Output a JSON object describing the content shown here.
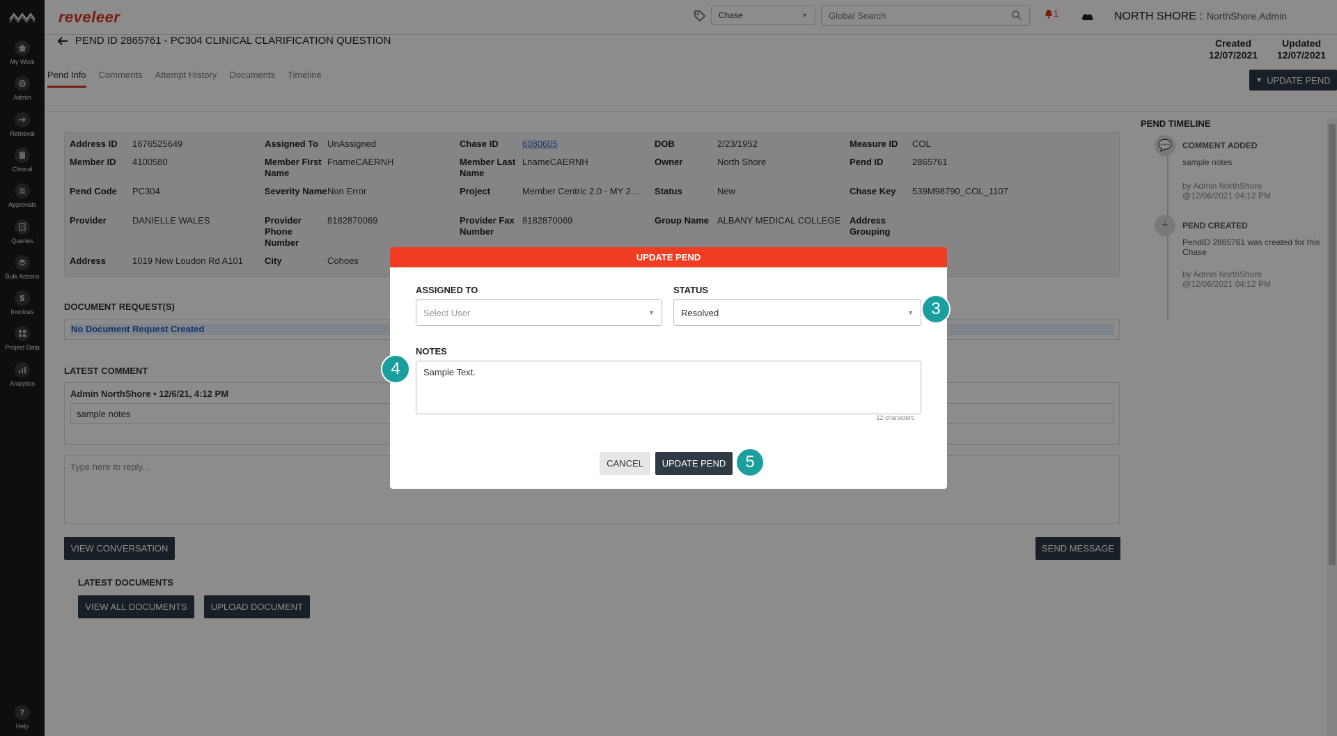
{
  "brand": "reveleer",
  "topbar": {
    "chase_select": "Chase",
    "search_placeholder": "Global Search",
    "notification_count": "1",
    "org": "NORTH SHORE :",
    "user": "NorthShore.Admin"
  },
  "nav": [
    {
      "label": "My Work",
      "icon": "home-icon"
    },
    {
      "label": "Admin",
      "icon": "gear-icon"
    },
    {
      "label": "Retrieval",
      "icon": "arrow-right-icon"
    },
    {
      "label": "Clinical",
      "icon": "clipboard-icon"
    },
    {
      "label": "Approvals",
      "icon": "list-icon"
    },
    {
      "label": "Queries",
      "icon": "document-icon"
    },
    {
      "label": "Bulk Actions",
      "icon": "layers-icon"
    },
    {
      "label": "Invoices",
      "icon": "dollar-icon"
    },
    {
      "label": "Project Data",
      "icon": "grid-icon"
    },
    {
      "label": "Analytics",
      "icon": "chart-icon"
    },
    {
      "label": "Help",
      "icon": "help-icon"
    }
  ],
  "page": {
    "title": "PEND ID 2865761 - PC304 CLINICAL CLARIFICATION QUESTION",
    "created_label": "Created",
    "created_date": "12/07/2021",
    "updated_label": "Updated",
    "updated_date": "12/07/2021",
    "update_button": "UPDATE PEND"
  },
  "tabs": [
    "Pend Info",
    "Comments",
    "Attempt History",
    "Documents",
    "Timeline"
  ],
  "info": {
    "address_id": {
      "label": "Address ID",
      "value": "1676525649"
    },
    "assigned_to": {
      "label": "Assigned To",
      "value": "UnAssigned"
    },
    "chase_id": {
      "label": "Chase ID",
      "value": "6080605"
    },
    "dob": {
      "label": "DOB",
      "value": "2/23/1952"
    },
    "measure_id": {
      "label": "Measure ID",
      "value": "COL"
    },
    "member_id": {
      "label": "Member ID",
      "value": "4100580"
    },
    "member_first": {
      "label": "Member First Name",
      "value": "FnameCAERNH"
    },
    "member_last": {
      "label": "Member Last Name",
      "value": "LnameCAERNH"
    },
    "owner": {
      "label": "Owner",
      "value": "North Shore"
    },
    "pend_id": {
      "label": "Pend ID",
      "value": "2865761"
    },
    "pend_code": {
      "label": "Pend Code",
      "value": "PC304"
    },
    "severity": {
      "label": "Severity Name",
      "value": "Non Error"
    },
    "project": {
      "label": "Project",
      "value": "Member Centric 2.0 - MY 2..."
    },
    "status": {
      "label": "Status",
      "value": "New"
    },
    "chase_key": {
      "label": "Chase Key",
      "value": "539M98790_COL_1107"
    },
    "provider": {
      "label": "Provider",
      "value": "DANIELLE WALES"
    },
    "provider_phone": {
      "label": "Provider Phone Number",
      "value": "8182870069"
    },
    "provider_fax": {
      "label": "Provider Fax Number",
      "value": "8182870069"
    },
    "group_name": {
      "label": "Group Name",
      "value": "ALBANY MEDICAL COLLEGE"
    },
    "address_grouping": {
      "label": "Address Grouping",
      "value": ""
    },
    "address": {
      "label": "Address",
      "value": "1019 New Loudon Rd A101"
    },
    "city": {
      "label": "City",
      "value": "Cohoes"
    }
  },
  "documents": {
    "title": "DOCUMENT REQUEST(S)",
    "empty": "No Document Request Created"
  },
  "comment": {
    "title": "LATEST COMMENT",
    "author": "Admin NorthShore • 12/6/21, 4:12 PM",
    "text": "sample notes",
    "reply_placeholder": "Type here to reply...",
    "view_conversation": "VIEW CONVERSATION",
    "send_message": "SEND MESSAGE"
  },
  "latest_documents": {
    "title": "LATEST DOCUMENTS",
    "view_all": "VIEW ALL DOCUMENTS",
    "upload": "UPLOAD DOCUMENT"
  },
  "timeline": {
    "title": "PEND TIMELINE",
    "items": [
      {
        "head": "COMMENT ADDED",
        "body": "sample notes",
        "by": "by Admin NorthShore",
        "at": "@12/06/2021 04:12 PM"
      },
      {
        "head": "PEND CREATED",
        "body": "PendID 2865761 was created for this Chase",
        "by": "by Admin NorthShore",
        "at": "@12/06/2021 04:12 PM"
      }
    ]
  },
  "modal": {
    "title": "UPDATE PEND",
    "assigned_label": "ASSIGNED TO",
    "assigned_placeholder": "Select User",
    "status_label": "STATUS",
    "status_value": "Resolved",
    "notes_label": "NOTES",
    "notes_value": "Sample Text.",
    "char_count": "12 characters",
    "cancel": "CANCEL",
    "submit": "UPDATE PEND"
  },
  "markers": [
    "3",
    "4",
    "5"
  ],
  "colors": {
    "brand": "#d9361c",
    "modal_header": "#f03c22",
    "dark_button": "#2f3a45",
    "marker": "#1a9e9e",
    "link": "#2060c8"
  }
}
